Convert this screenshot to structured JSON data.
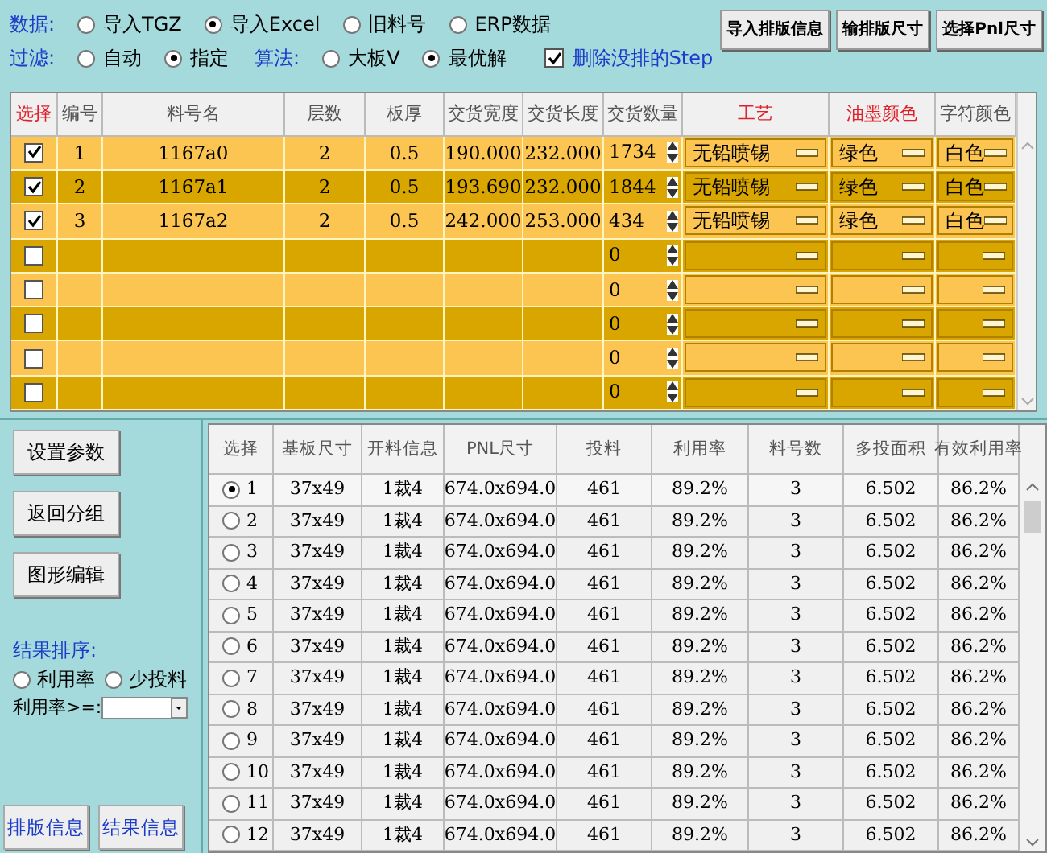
{
  "data_source": {
    "label": "数据:",
    "options": [
      {
        "label": "导入TGZ",
        "selected": false
      },
      {
        "label": "导入Excel",
        "selected": true
      },
      {
        "label": "旧料号",
        "selected": false
      },
      {
        "label": "ERP数据",
        "selected": false
      }
    ]
  },
  "filter": {
    "label": "过滤:",
    "options": [
      {
        "label": "自动",
        "selected": false
      },
      {
        "label": "指定",
        "selected": true
      }
    ]
  },
  "algorithm": {
    "label": "算法:",
    "options": [
      {
        "label": "大板V",
        "selected": false
      },
      {
        "label": "最优解",
        "selected": true
      }
    ]
  },
  "delete_unplaced": {
    "label": "删除没排的Step",
    "checked": true
  },
  "toolbar_buttons": [
    "导入排版信息",
    "输排版尺寸",
    "选择Pnl尺寸"
  ],
  "parts_table": {
    "columns": [
      {
        "label": "选择",
        "highlighted": true
      },
      {
        "label": "编号",
        "highlighted": false
      },
      {
        "label": "料号名",
        "highlighted": false
      },
      {
        "label": "层数",
        "highlighted": false
      },
      {
        "label": "板厚",
        "highlighted": false
      },
      {
        "label": "交货宽度",
        "highlighted": false
      },
      {
        "label": "交货长度",
        "highlighted": false
      },
      {
        "label": "交货数量",
        "highlighted": false
      },
      {
        "label": "工艺",
        "highlighted": true
      },
      {
        "label": "油墨颜色",
        "highlighted": true
      },
      {
        "label": "字符颜色",
        "highlighted": false
      }
    ],
    "rows": [
      {
        "checked": true,
        "cells": [
          "1",
          "1167a0",
          "2",
          "0.5",
          "190.000",
          "232.000"
        ],
        "qty": "1734",
        "process": "无铅喷锡",
        "ink": "绿色",
        "text_color": "白色"
      },
      {
        "checked": true,
        "cells": [
          "2",
          "1167a1",
          "2",
          "0.5",
          "193.690",
          "232.000"
        ],
        "qty": "1844",
        "process": "无铅喷锡",
        "ink": "绿色",
        "text_color": "白色"
      },
      {
        "checked": true,
        "cells": [
          "3",
          "1167a2",
          "2",
          "0.5",
          "242.000",
          "253.000"
        ],
        "qty": "434",
        "process": "无铅喷锡",
        "ink": "绿色",
        "text_color": "白色"
      },
      {
        "checked": false,
        "qty": "0"
      },
      {
        "checked": false,
        "qty": "0"
      },
      {
        "checked": false,
        "qty": "0"
      },
      {
        "checked": false,
        "qty": "0"
      },
      {
        "checked": false,
        "qty": "0"
      }
    ]
  },
  "side_buttons": [
    "设置参数",
    "返回分组",
    "图形编辑"
  ],
  "sort": {
    "label": "结果排序:",
    "options": [
      {
        "label": "利用率",
        "selected": false
      },
      {
        "label": "少投料",
        "selected": false
      }
    ]
  },
  "min_utilization": {
    "label": "利用率>=:"
  },
  "bottom_buttons": [
    "排版信息",
    "结果信息"
  ],
  "results_table": {
    "columns": [
      "选择",
      "基板尺寸",
      "开料信息",
      "PNL尺寸",
      "投料",
      "利用率",
      "料号数",
      "多投面积",
      "有效利用率"
    ],
    "rows": [
      {
        "selected": true,
        "cells": [
          "1",
          "37x49",
          "1裁4",
          "674.0x694.0",
          "461",
          "89.2%",
          "3",
          "6.502",
          "86.2%"
        ]
      },
      {
        "selected": false,
        "cells": [
          "2",
          "37x49",
          "1裁4",
          "674.0x694.0",
          "461",
          "89.2%",
          "3",
          "6.502",
          "86.2%"
        ]
      },
      {
        "selected": false,
        "cells": [
          "3",
          "37x49",
          "1裁4",
          "674.0x694.0",
          "461",
          "89.2%",
          "3",
          "6.502",
          "86.2%"
        ]
      },
      {
        "selected": false,
        "cells": [
          "4",
          "37x49",
          "1裁4",
          "674.0x694.0",
          "461",
          "89.2%",
          "3",
          "6.502",
          "86.2%"
        ]
      },
      {
        "selected": false,
        "cells": [
          "5",
          "37x49",
          "1裁4",
          "674.0x694.0",
          "461",
          "89.2%",
          "3",
          "6.502",
          "86.2%"
        ]
      },
      {
        "selected": false,
        "cells": [
          "6",
          "37x49",
          "1裁4",
          "674.0x694.0",
          "461",
          "89.2%",
          "3",
          "6.502",
          "86.2%"
        ]
      },
      {
        "selected": false,
        "cells": [
          "7",
          "37x49",
          "1裁4",
          "674.0x694.0",
          "461",
          "89.2%",
          "3",
          "6.502",
          "86.2%"
        ]
      },
      {
        "selected": false,
        "cells": [
          "8",
          "37x49",
          "1裁4",
          "674.0x694.0",
          "461",
          "89.2%",
          "3",
          "6.502",
          "86.2%"
        ]
      },
      {
        "selected": false,
        "cells": [
          "9",
          "37x49",
          "1裁4",
          "674.0x694.0",
          "461",
          "89.2%",
          "3",
          "6.502",
          "86.2%"
        ]
      },
      {
        "selected": false,
        "cells": [
          "10",
          "37x49",
          "1裁4",
          "674.0x694.0",
          "461",
          "89.2%",
          "3",
          "6.502",
          "86.2%"
        ]
      },
      {
        "selected": false,
        "cells": [
          "11",
          "37x49",
          "1裁4",
          "674.0x694.0",
          "461",
          "89.2%",
          "3",
          "6.502",
          "86.2%"
        ]
      },
      {
        "selected": false,
        "cells": [
          "12",
          "37x49",
          "1裁4",
          "674.0x694.0",
          "461",
          "89.2%",
          "3",
          "6.502",
          "86.2%"
        ]
      }
    ]
  }
}
